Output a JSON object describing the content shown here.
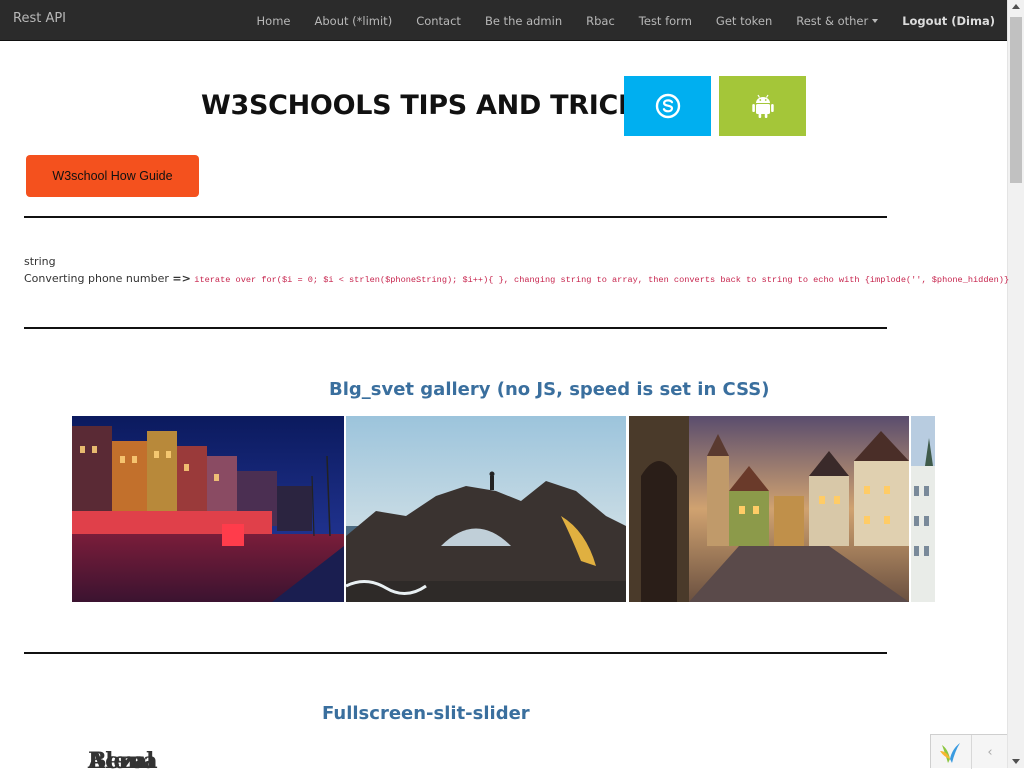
{
  "navbar": {
    "brand": "Rest API",
    "items": [
      {
        "label": "Home"
      },
      {
        "label": "About (*limit)"
      },
      {
        "label": "Contact"
      },
      {
        "label": "Be the admin"
      },
      {
        "label": "Rbac"
      },
      {
        "label": "Test form"
      },
      {
        "label": "Get token"
      },
      {
        "label": "Rest & other",
        "dropdown": true
      },
      {
        "label": "Logout (Dima)"
      }
    ]
  },
  "header": {
    "title": "W3SCHOOLS TIPS AND TRICKS",
    "tiles": [
      {
        "icon": "skype-icon",
        "color": "#00aff0"
      },
      {
        "icon": "android-icon",
        "color": "#a4c639"
      }
    ],
    "guide_button": "W3school How Guide",
    "guide_color": "#f4511e"
  },
  "tip": {
    "title": "string",
    "label": "Converting phone number",
    "arrow": "=>",
    "code": "iterate over for($i = 0; $i < strlen($phoneString); $i++){ }, changing string to array, then converts back to string to echo with {implode('', $phone_hidden)}"
  },
  "gallery": {
    "heading": "Blg_svet gallery (no JS, speed is set in CSS)",
    "images": [
      {
        "subject": "night-harbor-street"
      },
      {
        "subject": "rock-arch-hiker"
      },
      {
        "subject": "old-town-dusk"
      },
      {
        "subject": "white-town-building"
      }
    ]
  },
  "slider": {
    "heading": "Fullscreen-slit-slider",
    "overlay_words": [
      "Acrul",
      "Alena",
      "Beza"
    ]
  }
}
